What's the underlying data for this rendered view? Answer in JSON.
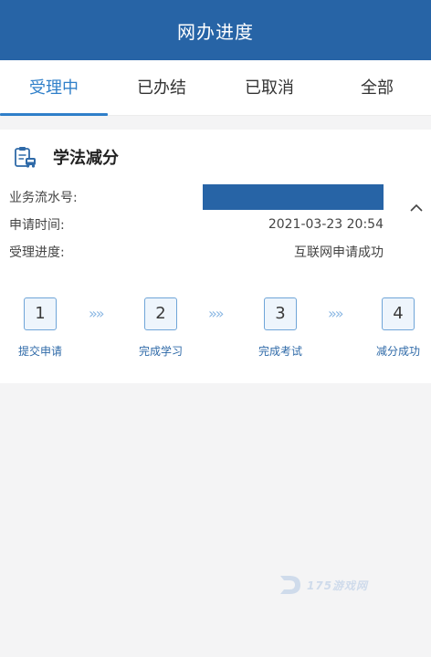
{
  "header": {
    "title": "网办进度"
  },
  "tabs": [
    {
      "label": "受理中",
      "active": true
    },
    {
      "label": "已办结",
      "active": false
    },
    {
      "label": "已取消",
      "active": false
    },
    {
      "label": "全部",
      "active": false
    }
  ],
  "card": {
    "title": "学法减分",
    "rows": [
      {
        "label": "业务流水号:",
        "value": ""
      },
      {
        "label": "申请时间:",
        "value": "2021-03-23 20:54"
      },
      {
        "label": "受理进度:",
        "value": "互联网申请成功"
      }
    ],
    "steps": [
      {
        "number": "1",
        "label": "提交申请"
      },
      {
        "number": "2",
        "label": "完成学习"
      },
      {
        "number": "3",
        "label": "完成考试"
      },
      {
        "number": "4",
        "label": "减分成功"
      }
    ],
    "arrow_glyph": "»»"
  },
  "watermark": {
    "text": "175游戏网"
  },
  "colors": {
    "primary": "#2764a6",
    "accent": "#2f7fc9"
  }
}
